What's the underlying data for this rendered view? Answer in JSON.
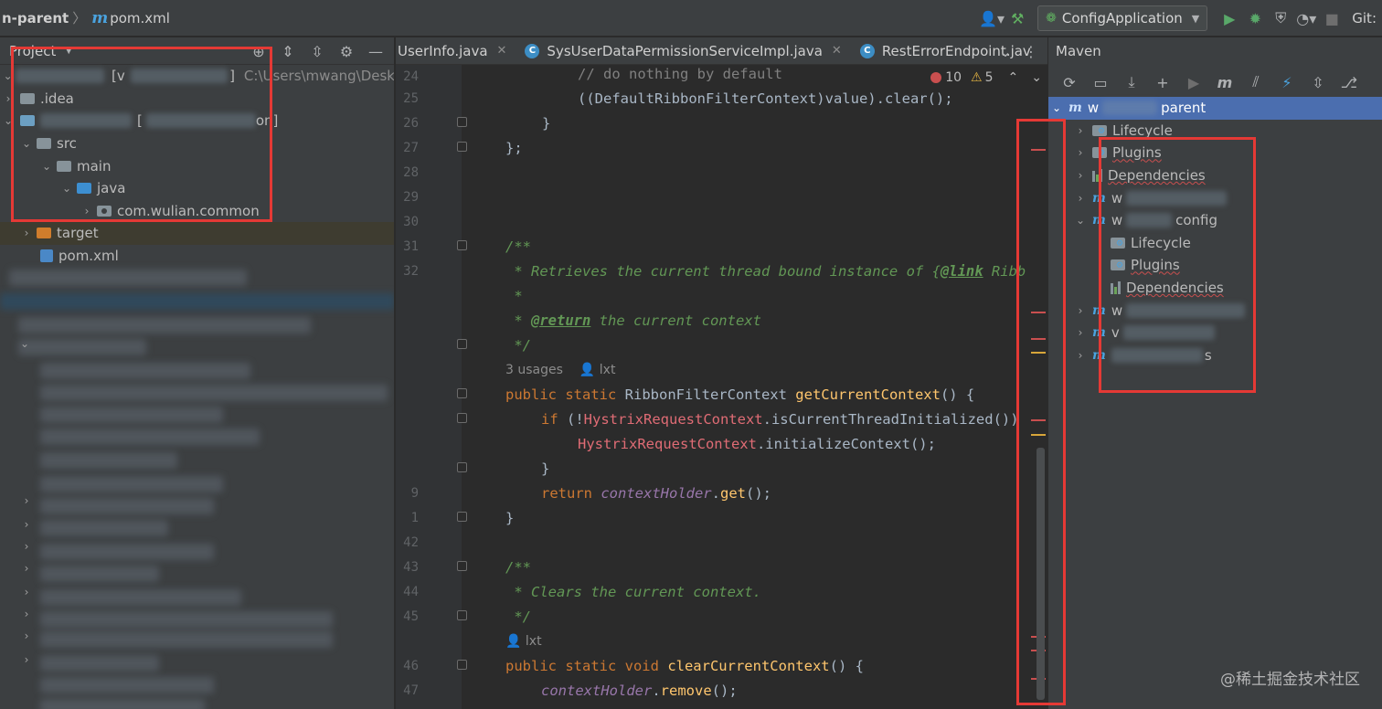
{
  "breadcrumb": {
    "project": "n-parent",
    "file": "pom.xml"
  },
  "toolbar": {
    "run_config": "ConfigApplication",
    "git_label": "Git:"
  },
  "project_panel": {
    "title": "Project",
    "root_suffix": "[v",
    "root_path": "C:\\Users\\mwang\\Desk",
    "items": [
      {
        "label": ".idea"
      },
      {
        "label": "[",
        "suffix": "on]"
      },
      {
        "label": "src"
      },
      {
        "label": "main"
      },
      {
        "label": "java"
      },
      {
        "label": "com.wulian.common"
      },
      {
        "label": "target"
      },
      {
        "label": "pom.xml"
      }
    ]
  },
  "editor": {
    "tabs": [
      {
        "label": "UserInfo.java"
      },
      {
        "label": "SysUserDataPermissionServiceImpl.java"
      },
      {
        "label": "RestErrorEndpoint.jav"
      }
    ],
    "inspection": {
      "errors": "10",
      "warnings": "5"
    },
    "line_numbers": [
      "24",
      "25",
      "26",
      "27",
      "28",
      "29",
      "30",
      "31",
      "32",
      "",
      "",
      "",
      "",
      "",
      "",
      "",
      "",
      "",
      "",
      "",
      "42",
      "43",
      "44",
      "45",
      "",
      "46",
      "47"
    ],
    "visible_numbers": {
      "l39": "9",
      "l41": "1"
    },
    "lines": {
      "l24": "// do nothing by default",
      "l25": "((DefaultRibbonFilterContext)value).clear();",
      "l26": "}",
      "l27": "};",
      "l31": "/**",
      "l32a": " * Retrieves the current thread bound instance of {",
      "l32b": "@link",
      "l32c": " Ribb",
      "l33": " *",
      "l34a": " * ",
      "l34b": "@return",
      "l34c": " the current context",
      "l35": " */",
      "hint1": "3 usages",
      "hint1_author": "lxt",
      "l36a": "public static ",
      "l36b": "RibbonFilterContext ",
      "l36c": "getCurrentContext",
      "l36d": "() {",
      "l37a": "if ",
      "l37b": "(!",
      "l37c": "HystrixRequestContext",
      "l37d": ".isCurrentThreadInitialized())",
      "l38a": "HystrixRequestContext",
      "l38b": ".initializeContext();",
      "l39": "}",
      "l40a": "return ",
      "l40b": "contextHolder",
      "l40c": ".",
      "l40d": "get",
      "l40e": "();",
      "l41": "}",
      "l43": "/**",
      "l44": " * Clears the current context.",
      "l45": " */",
      "hint2_author": "lxt",
      "l46a": "public static void ",
      "l46b": "clearCurrentContext",
      "l46c": "() {",
      "l47a": "contextHolder",
      "l47b": ".",
      "l47c": "remove",
      "l47d": "();"
    }
  },
  "maven_panel": {
    "title": "Maven",
    "root": "parent",
    "root_prefix": "w",
    "items": [
      {
        "label": "Lifecycle"
      },
      {
        "label": "Plugins"
      },
      {
        "label": "Dependencies"
      },
      {
        "label": "w"
      },
      {
        "label": "w",
        "suffix": "config"
      },
      {
        "label": "Lifecycle"
      },
      {
        "label": "Plugins"
      },
      {
        "label": "Dependencies"
      },
      {
        "label": "w"
      },
      {
        "label": "v"
      },
      {
        "label": "s"
      }
    ]
  },
  "watermark": "@稀土掘金技术社区"
}
